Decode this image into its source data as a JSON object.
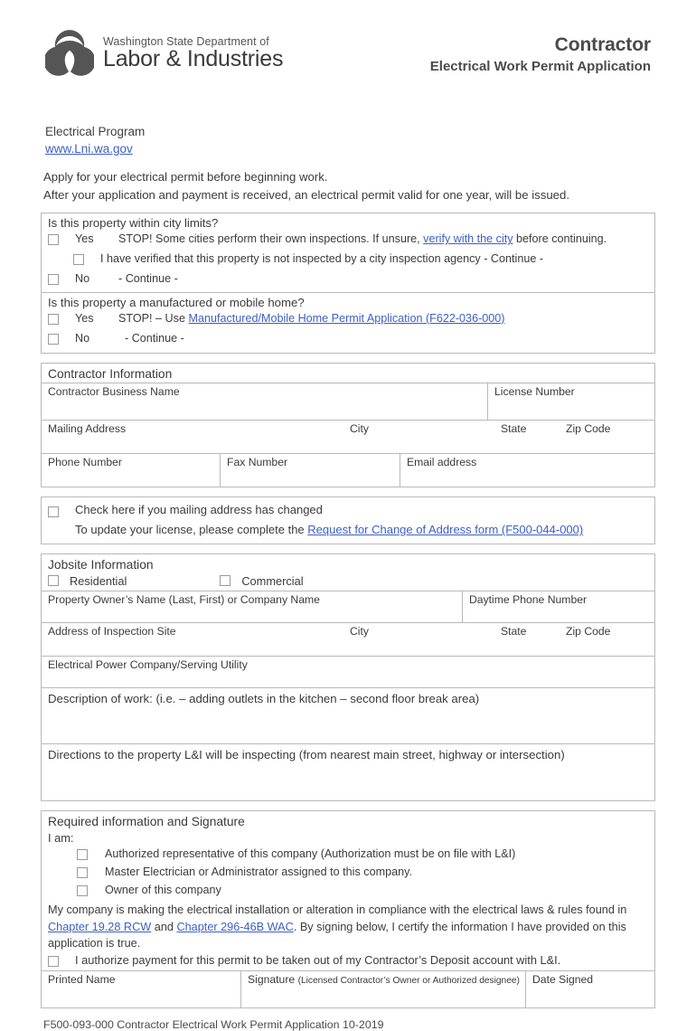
{
  "header": {
    "agency_line1": "Washington State Department of",
    "agency_line2": "Labor & Industries",
    "logo_icon": "li-trefoil-logo",
    "title_main": "Contractor",
    "title_sub": "Electrical Work Permit Application",
    "program": "Electrical Program",
    "website": "www.Lni.wa.gov"
  },
  "intro": {
    "line1": "Apply for your electrical permit before beginning work.",
    "line2": "After your application and payment is received, an electrical permit valid for one year, will be issued."
  },
  "city_limits": {
    "question": "Is this property within city limits?",
    "yes_label": "Yes",
    "yes_text_before": "STOP! Some cities perform their own inspections. If unsure, ",
    "yes_link": "verify with the city",
    "yes_text_after": " before continuing.",
    "verified_text": "I have verified that this property is not inspected by a city inspection agency  - Continue -",
    "no_label": "No",
    "no_text": "- Continue -"
  },
  "mobile_home": {
    "question": "Is this property a manufactured or mobile home?",
    "yes_label": "Yes",
    "yes_text_before": "STOP! – Use ",
    "yes_link": "Manufactured/Mobile Home Permit Application (F622-036-000)",
    "no_label": "No",
    "no_text": "- Continue -"
  },
  "contractor": {
    "section_title": "Contractor Information",
    "business_name": "Contractor Business Name",
    "license_number": "License Number",
    "mailing_address": "Mailing Address",
    "city": "City",
    "state": "State",
    "zip": "Zip Code",
    "phone": "Phone Number",
    "fax": "Fax Number",
    "email": "Email address"
  },
  "address_change": {
    "checkbox_label": "Check here if you mailing address has changed",
    "update_text": "To update your license, please complete the ",
    "update_link": "Request for Change of Address form (F500-044-000)"
  },
  "jobsite": {
    "section_title": "Jobsite Information",
    "residential": "Residential",
    "commercial": "Commercial",
    "owner_name": "Property Owner’s Name (Last, First) or Company Name",
    "daytime_phone": "Daytime Phone Number",
    "inspection_address": "Address of Inspection Site",
    "city": "City",
    "state": "State",
    "zip": "Zip Code",
    "power_company": "Electrical Power Company/Serving Utility",
    "description": "Description of work: (i.e. – adding outlets in the kitchen – second floor break area)",
    "directions": "Directions to the property L&I will be inspecting (from nearest main street, highway or intersection)"
  },
  "signature": {
    "section_title": "Required information and Signature",
    "i_am": "I am:",
    "option1": "Authorized representative of this company (Authorization must be on file with L&I)",
    "option2": "Master Electrician or Administrator assigned to this company.",
    "option3": "Owner of this company",
    "legal_part1": "My company is making the electrical installation or alteration in compliance with the electrical laws & rules found in ",
    "legal_link1": "Chapter 19.28 RCW",
    "legal_and": " and ",
    "legal_link2": "Chapter 296-46B WAC",
    "legal_part2": ".  By signing below, I certify the information I have provided on this application is true.",
    "authorize_payment": "I authorize payment for this permit to be taken out of my Contractor’s Deposit account with L&I.",
    "printed_name": "Printed Name",
    "signature_label": "Signature ",
    "signature_note": "(Licensed Contractor’s Owner or Authorized designee)",
    "date_signed": "Date Signed"
  },
  "footer": "F500-093-000 Contractor Electrical Work Permit Application  10-2019",
  "colors": {
    "link": "#3d5fc4",
    "border": "#b9b9b9",
    "text": "#3b3b3b",
    "logo": "#555555"
  }
}
